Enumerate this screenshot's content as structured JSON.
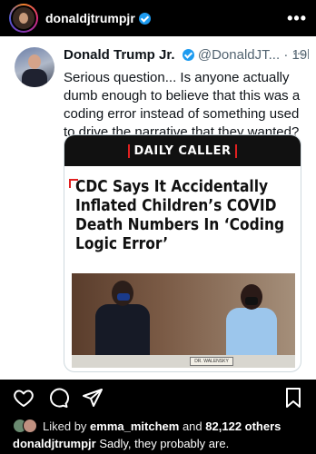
{
  "ig_header": {
    "username": "donaldjtrumpjr",
    "more_icon": "more-horizontal-icon"
  },
  "tweet": {
    "name": "Donald Trump Jr.",
    "handle": "@DonaldJT...",
    "time": "19h",
    "text": "Serious question... Is anyone actually dumb enough to believe that this was a coding error instead of something used to drive the narrative that they wanted?",
    "article": {
      "source": "DAILY CALLER",
      "headline": "CDC Says It Accidentally Inflated Children’s COVID Death Numbers In ‘Coding Logic Error’",
      "nameplate": "DR. WALENSKY"
    }
  },
  "actions": {
    "icons": [
      "heart-icon",
      "comment-icon",
      "share-icon",
      "bookmark-icon"
    ]
  },
  "likes": {
    "prefix": "Liked by",
    "user": "emma_mitchem",
    "conjunction": "and",
    "others": "82,122 others"
  },
  "caption": {
    "username": "donaldjtrumpjr",
    "text": "Sadly, they probably are."
  },
  "colors": {
    "accent_blue": "#1d9bf0",
    "daily_caller_red": "#e02020",
    "background": "#000000"
  }
}
